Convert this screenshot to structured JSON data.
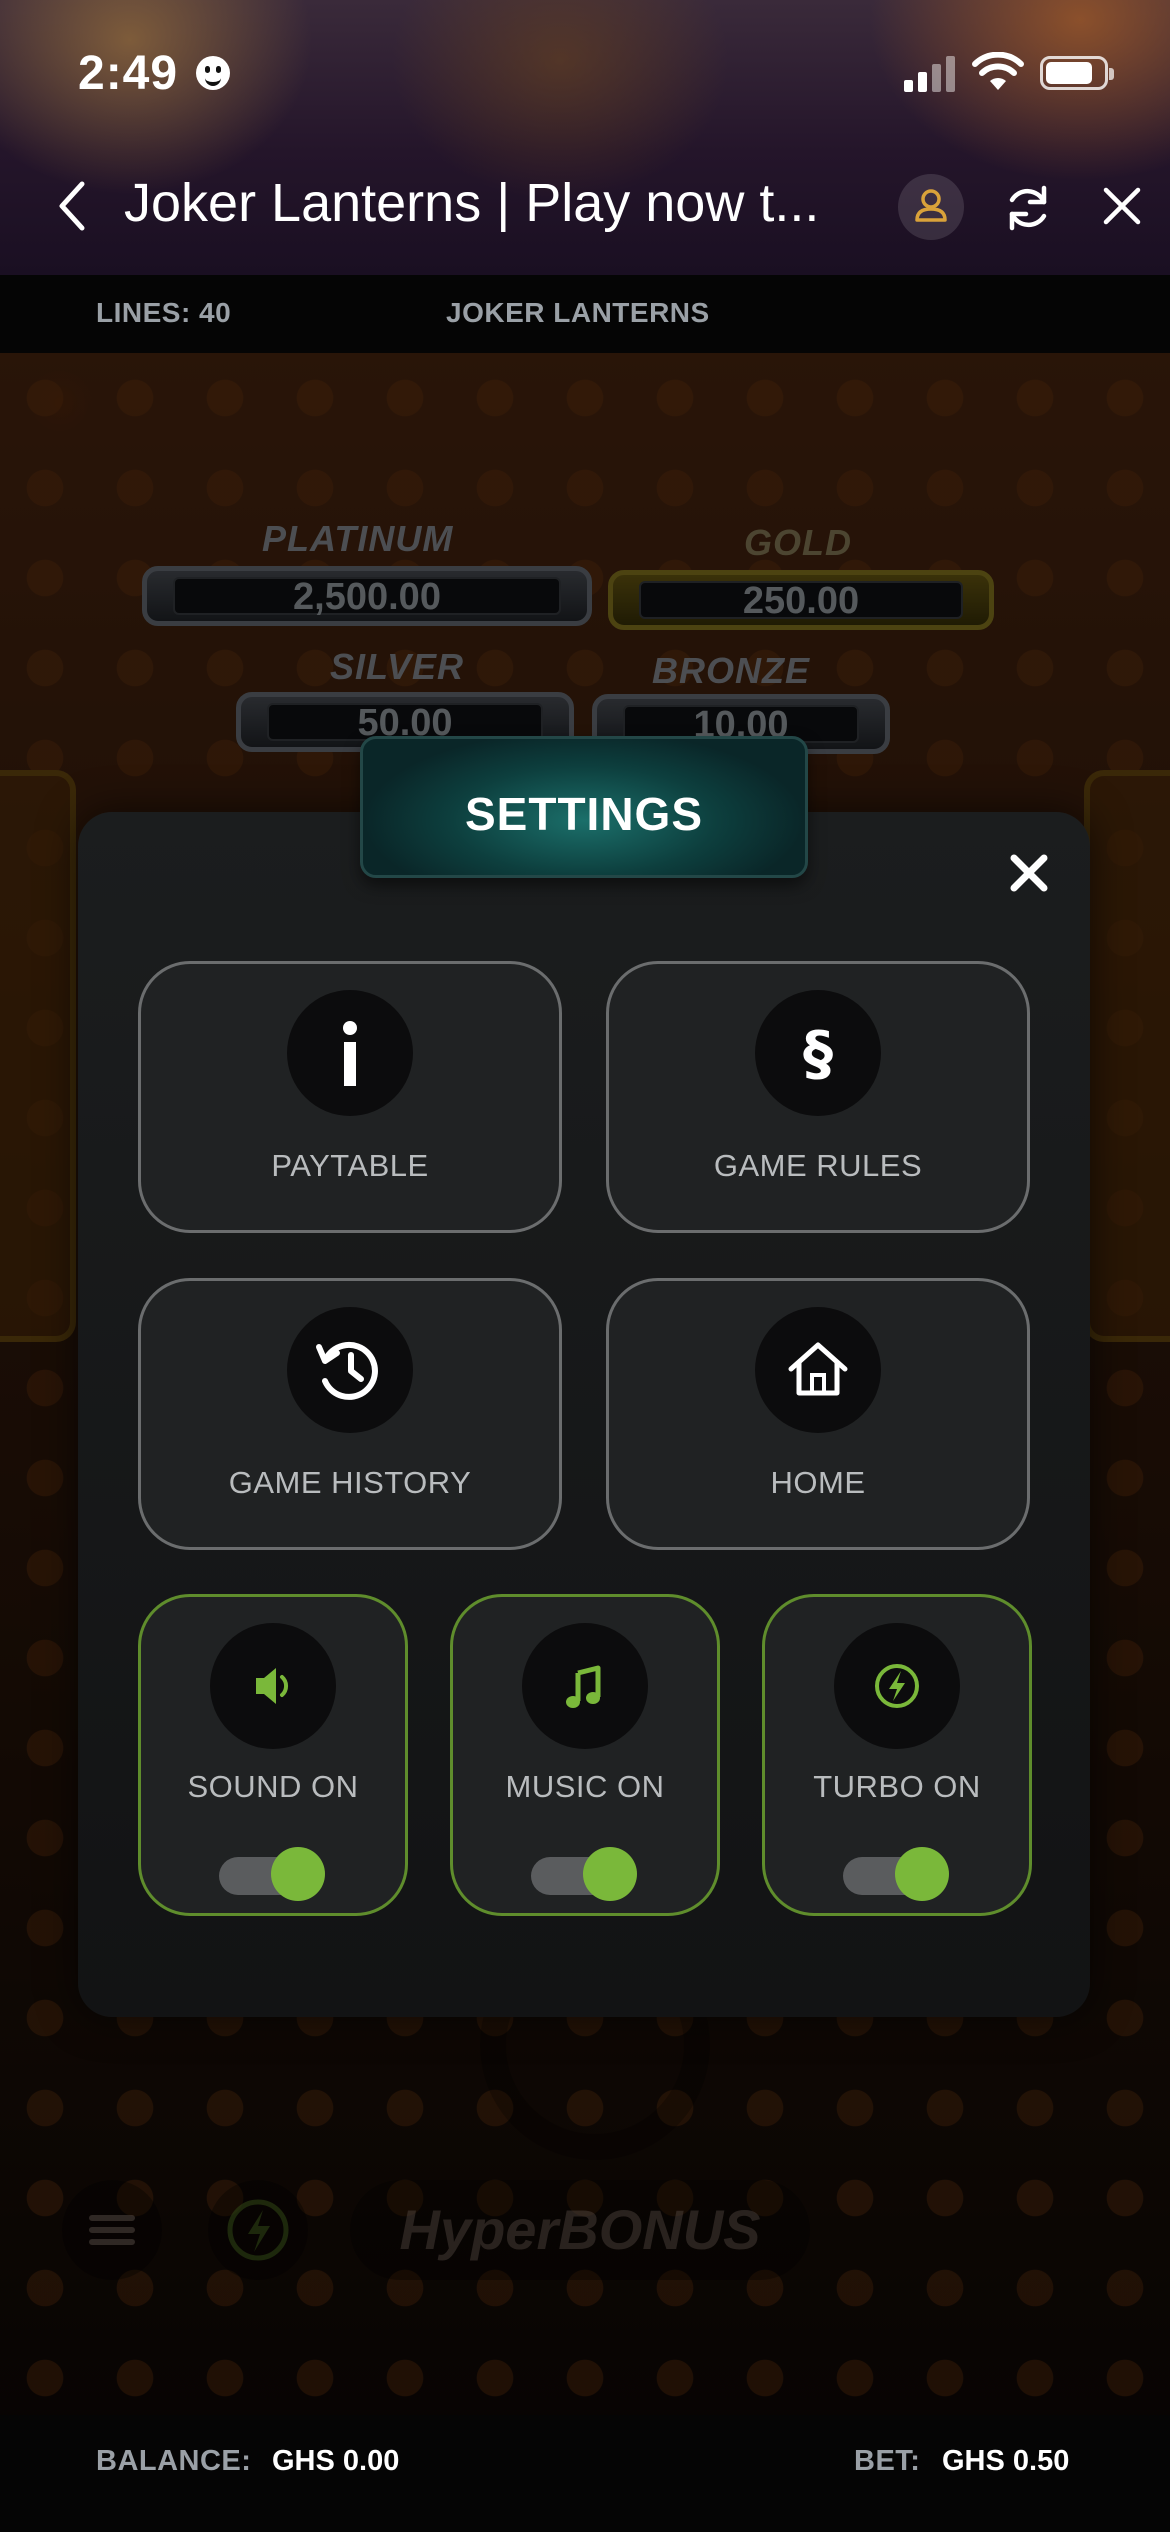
{
  "status_bar": {
    "time": "2:49"
  },
  "browser": {
    "title": "Joker Lanterns | Play now t..."
  },
  "game_header": {
    "lines_label": "LINES: 40",
    "game_name": "JOKER LANTERNS"
  },
  "jackpots": [
    {
      "label": "PLATINUM",
      "value": "2,500.00"
    },
    {
      "label": "GOLD",
      "value": "250.00"
    },
    {
      "label": "SILVER",
      "value": "50.00"
    },
    {
      "label": "BRONZE",
      "value": "10.00"
    }
  ],
  "background_labels": {
    "hyper_bonus": "HyperBONUS"
  },
  "settings": {
    "title": "SETTINGS",
    "tiles": [
      {
        "label": "PAYTABLE",
        "icon": "info-icon"
      },
      {
        "label": "GAME RULES",
        "icon": "section-sign-icon"
      },
      {
        "label": "GAME HISTORY",
        "icon": "history-icon"
      },
      {
        "label": "HOME",
        "icon": "home-icon"
      }
    ],
    "toggles": [
      {
        "label": "SOUND ON",
        "icon": "speaker-icon",
        "on": true
      },
      {
        "label": "MUSIC ON",
        "icon": "music-note-icon",
        "on": true
      },
      {
        "label": "TURBO ON",
        "icon": "lightning-icon",
        "on": true
      }
    ],
    "accent_color": "#7ab83a",
    "title_color": "#1b6f6a"
  },
  "footer": {
    "balance_label": "BALANCE:",
    "balance_value": "GHS 0.00",
    "bet_label": "BET:",
    "bet_value": "GHS 0.50"
  }
}
